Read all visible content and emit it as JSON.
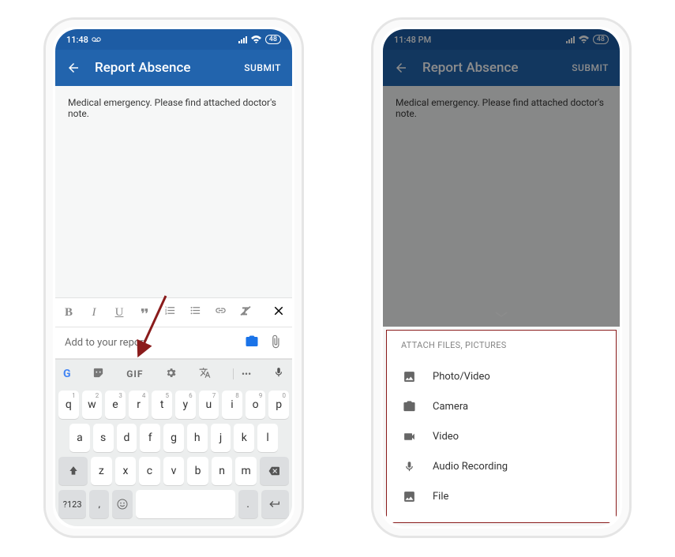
{
  "status": {
    "time_left": "11:48",
    "time_right": "11:48 PM",
    "battery": "48"
  },
  "appbar": {
    "title": "Report Absence",
    "submit": "SUBMIT"
  },
  "note": {
    "text": "Medical emergency. Please find attached doctor's note."
  },
  "toolbar": {
    "bold": "B",
    "italic": "I",
    "underline": "U",
    "quote": "❝",
    "ol": "≣",
    "ul": "≣",
    "link": "🔗",
    "clear": "⌫",
    "close": "✕"
  },
  "add_row": {
    "placeholder": "Add to your report"
  },
  "keyboard": {
    "suggest_gif": "GIF",
    "suggest_more": "•••",
    "row1": [
      {
        "k": "q",
        "s": "1"
      },
      {
        "k": "w",
        "s": "2"
      },
      {
        "k": "e",
        "s": "3"
      },
      {
        "k": "r",
        "s": "4"
      },
      {
        "k": "t",
        "s": "5"
      },
      {
        "k": "y",
        "s": "6"
      },
      {
        "k": "u",
        "s": "7"
      },
      {
        "k": "i",
        "s": "8"
      },
      {
        "k": "o",
        "s": "9"
      },
      {
        "k": "p",
        "s": "0"
      }
    ],
    "row2": [
      "a",
      "s",
      "d",
      "f",
      "g",
      "h",
      "j",
      "k",
      "l"
    ],
    "row3": [
      "z",
      "x",
      "c",
      "v",
      "b",
      "n",
      "m"
    ],
    "sym": "?123",
    "comma": ",",
    "period": "."
  },
  "attach": {
    "header": "ATTACH FILES, PICTURES",
    "items": [
      {
        "label": "Photo/Video"
      },
      {
        "label": "Camera"
      },
      {
        "label": "Video"
      },
      {
        "label": "Audio Recording"
      },
      {
        "label": "File"
      }
    ]
  }
}
